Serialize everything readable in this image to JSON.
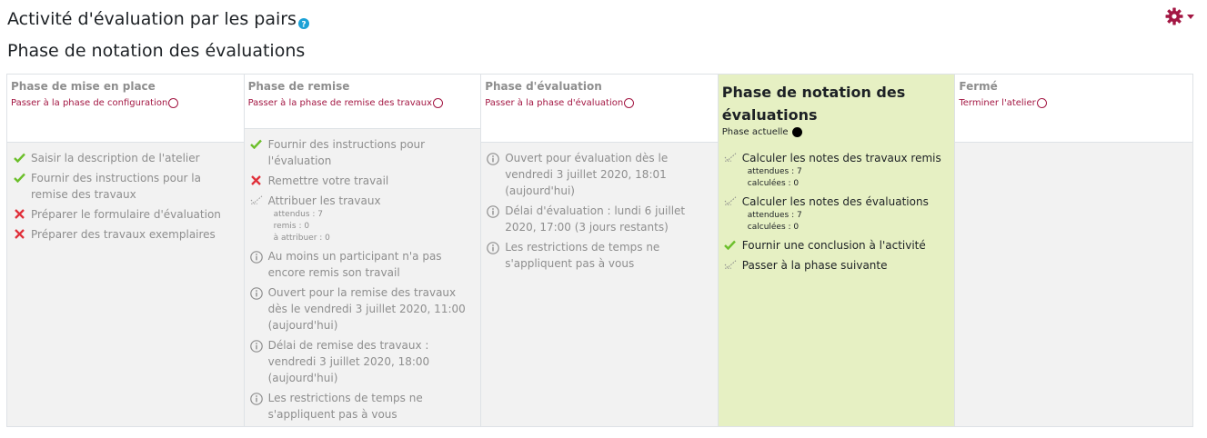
{
  "header": {
    "title": "Activité d'évaluation par les pairs",
    "help_icon": "question-circle-icon",
    "subtitle": "Phase de notation des évaluations",
    "settings_icon": "gear-icon",
    "accent_color": "#a31743"
  },
  "phases": [
    {
      "name": "Phase de mise en place",
      "link": "Passer à la phase de configuration",
      "tasks": [
        {
          "status": "done",
          "text": "Saisir la description de l'atelier"
        },
        {
          "status": "done",
          "text": "Fournir des instructions pour la remise des travaux"
        },
        {
          "status": "fail",
          "text": "Préparer le formulaire d'évaluation"
        },
        {
          "status": "fail",
          "text": "Préparer des travaux exemplaires"
        }
      ]
    },
    {
      "name": "Phase de remise",
      "link": "Passer à la phase de remise des travaux",
      "tasks": [
        {
          "status": "done",
          "text": "Fournir des instructions pour l'évaluation"
        },
        {
          "status": "fail",
          "text": "Remettre votre travail"
        },
        {
          "status": "todo",
          "text": "Attribuer les travaux",
          "details": [
            "attendus : 7",
            "remis : 0",
            "à attribuer : 0"
          ]
        },
        {
          "status": "info",
          "text": "Au moins un participant n'a pas encore remis son travail"
        },
        {
          "status": "info",
          "text": "Ouvert pour la remise des travaux dès le vendredi 3 juillet 2020, 11:00 (aujourd'hui)"
        },
        {
          "status": "info",
          "text": "Délai de remise des travaux : vendredi 3 juillet 2020, 18:00 (aujourd'hui)"
        },
        {
          "status": "info",
          "text": "Les restrictions de temps ne s'appliquent pas à vous"
        }
      ]
    },
    {
      "name": "Phase d'évaluation",
      "link": "Passer à la phase d'évaluation",
      "tasks": [
        {
          "status": "info",
          "text": "Ouvert pour évaluation dès le vendredi 3 juillet 2020, 18:01 (aujourd'hui)"
        },
        {
          "status": "info",
          "text": "Délai d'évaluation : lundi 6 juillet 2020, 17:00 (3 jours restants)"
        },
        {
          "status": "info",
          "text": "Les restrictions de temps ne s'appliquent pas à vous"
        }
      ]
    },
    {
      "name": "Phase de notation des évaluations",
      "current_label": "Phase actuelle",
      "active": true,
      "tasks": [
        {
          "status": "todo",
          "text": "Calculer les notes des travaux remis",
          "details": [
            "attendues : 7",
            "calculées : 0"
          ]
        },
        {
          "status": "todo",
          "text": "Calculer les notes des évaluations",
          "details": [
            "attendues : 7",
            "calculées : 0"
          ]
        },
        {
          "status": "done",
          "text": "Fournir une conclusion à l'activité"
        },
        {
          "status": "todo",
          "text": "Passer à la phase suivante"
        }
      ]
    },
    {
      "name": "Fermé",
      "link": "Terminer l'atelier",
      "tasks": []
    }
  ]
}
